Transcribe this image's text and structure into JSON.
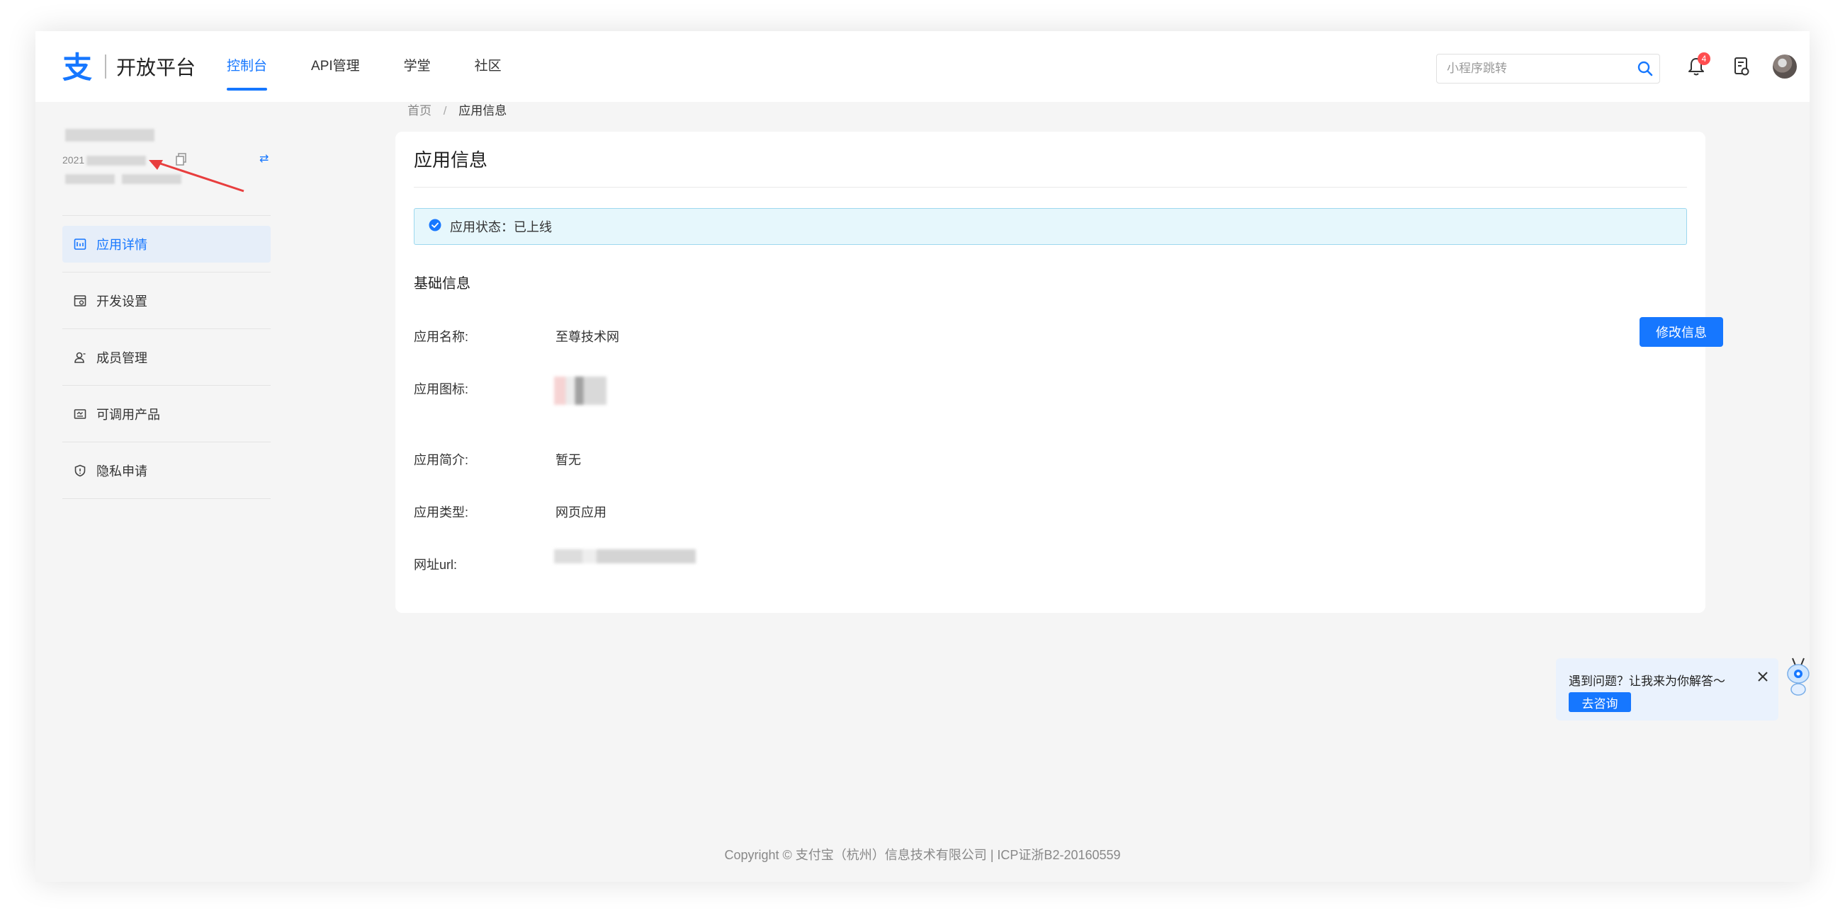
{
  "header": {
    "logo_text": "开放平台",
    "nav": [
      {
        "label": "控制台",
        "active": true
      },
      {
        "label": "API管理",
        "active": false
      },
      {
        "label": "学堂",
        "active": false
      },
      {
        "label": "社区",
        "active": false
      }
    ],
    "search_placeholder": "小程序跳转",
    "notification_count": "4",
    "icons": [
      "search-icon",
      "bell-icon",
      "document-icon",
      "avatar"
    ]
  },
  "sidebar": {
    "app_id_prefix": "2021",
    "menu": [
      {
        "label": "应用详情",
        "icon": "app-detail-icon",
        "active": true
      },
      {
        "label": "开发设置",
        "icon": "dev-settings-icon",
        "active": false
      },
      {
        "label": "成员管理",
        "icon": "members-icon",
        "active": false
      },
      {
        "label": "可调用产品",
        "icon": "products-icon",
        "active": false
      },
      {
        "label": "隐私申请",
        "icon": "privacy-shield-icon",
        "active": false
      }
    ]
  },
  "breadcrumb": {
    "home": "首页",
    "separator": "/",
    "current": "应用信息"
  },
  "card": {
    "title": "应用信息",
    "status_text": "应用状态：已上线",
    "section_title": "基础信息",
    "edit_button": "修改信息",
    "fields": [
      {
        "label": "应用名称:",
        "value": "至尊技术网"
      },
      {
        "label": "应用图标:",
        "value": ""
      },
      {
        "label": "应用简介:",
        "value": "暂无"
      },
      {
        "label": "应用类型:",
        "value": "网页应用"
      },
      {
        "label": "网址url:",
        "value": ""
      }
    ]
  },
  "help": {
    "text": "遇到问题？让我来为你解答～",
    "button": "去咨询"
  },
  "footer": {
    "text": "Copyright © 支付宝（杭州）信息技术有限公司  |  ICP证浙B2-20160559"
  },
  "colors": {
    "accent": "#1677ff",
    "status_bg": "#e6f7fc",
    "badge": "#ff4d4f",
    "page_bg": "#f5f5f5"
  }
}
